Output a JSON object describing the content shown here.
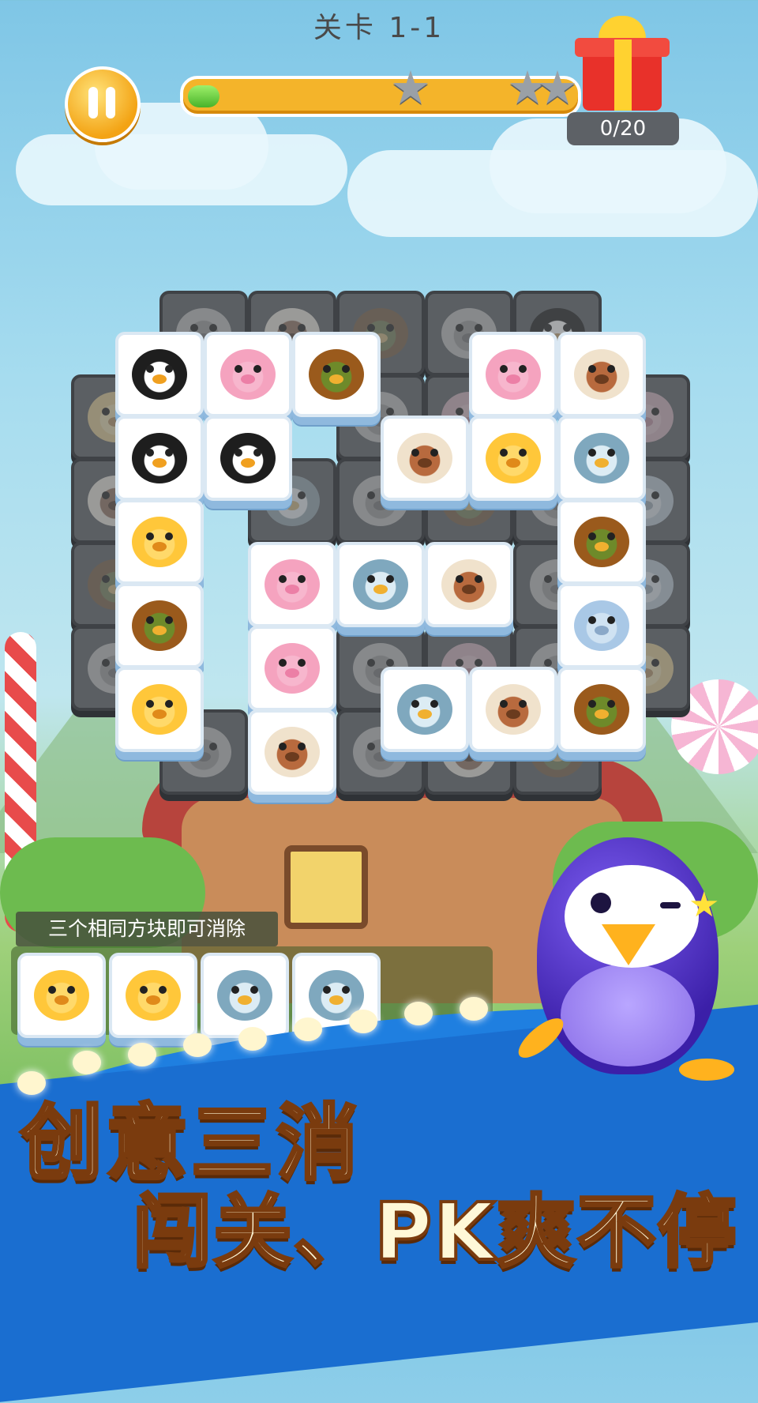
{
  "header": {
    "level_title": "关卡 1-1",
    "counter": "0/20",
    "progress_fraction": 0.05,
    "stars_earned": 0,
    "stars_total": 3
  },
  "icons": {
    "pause": "pause-icon",
    "gift": "gift-box-icon",
    "star": "star-icon"
  },
  "board": {
    "front_tiles": [
      "penguin",
      "pig",
      "owl-brown",
      "pig",
      "dog",
      "penguin",
      "penguin",
      "dog",
      "tiger",
      "owl-blue",
      "tiger",
      "owl-brown",
      "pig",
      "owl-blue",
      "dog",
      "tiger",
      "owl-brown",
      "mouse",
      "pig",
      "tiger",
      "owl-blue",
      "dog",
      "owl-brown",
      "dog"
    ],
    "back_tiles": [
      "cat",
      "dog",
      "owl-brown",
      "cat",
      "penguin",
      "tiger",
      "cat",
      "pig",
      "pig",
      "dog",
      "owl-blue",
      "cat",
      "owl-brown",
      "cat",
      "mouse",
      "owl-brown",
      "cat",
      "mouse",
      "cat",
      "cat",
      "pig",
      "cat",
      "tiger",
      "cat"
    ]
  },
  "tray": {
    "tip": "三个相同方块即可消除",
    "tiles": [
      "tiger",
      "tiger",
      "owl-blue",
      "owl-blue"
    ]
  },
  "banner": {
    "line1": "创意三消",
    "line2": "闯关、PK爽不停"
  },
  "colors": {
    "accent_orange": "#f4b42a",
    "banner_blue": "#1f7fe0",
    "tile_back": "#5b5f63"
  }
}
